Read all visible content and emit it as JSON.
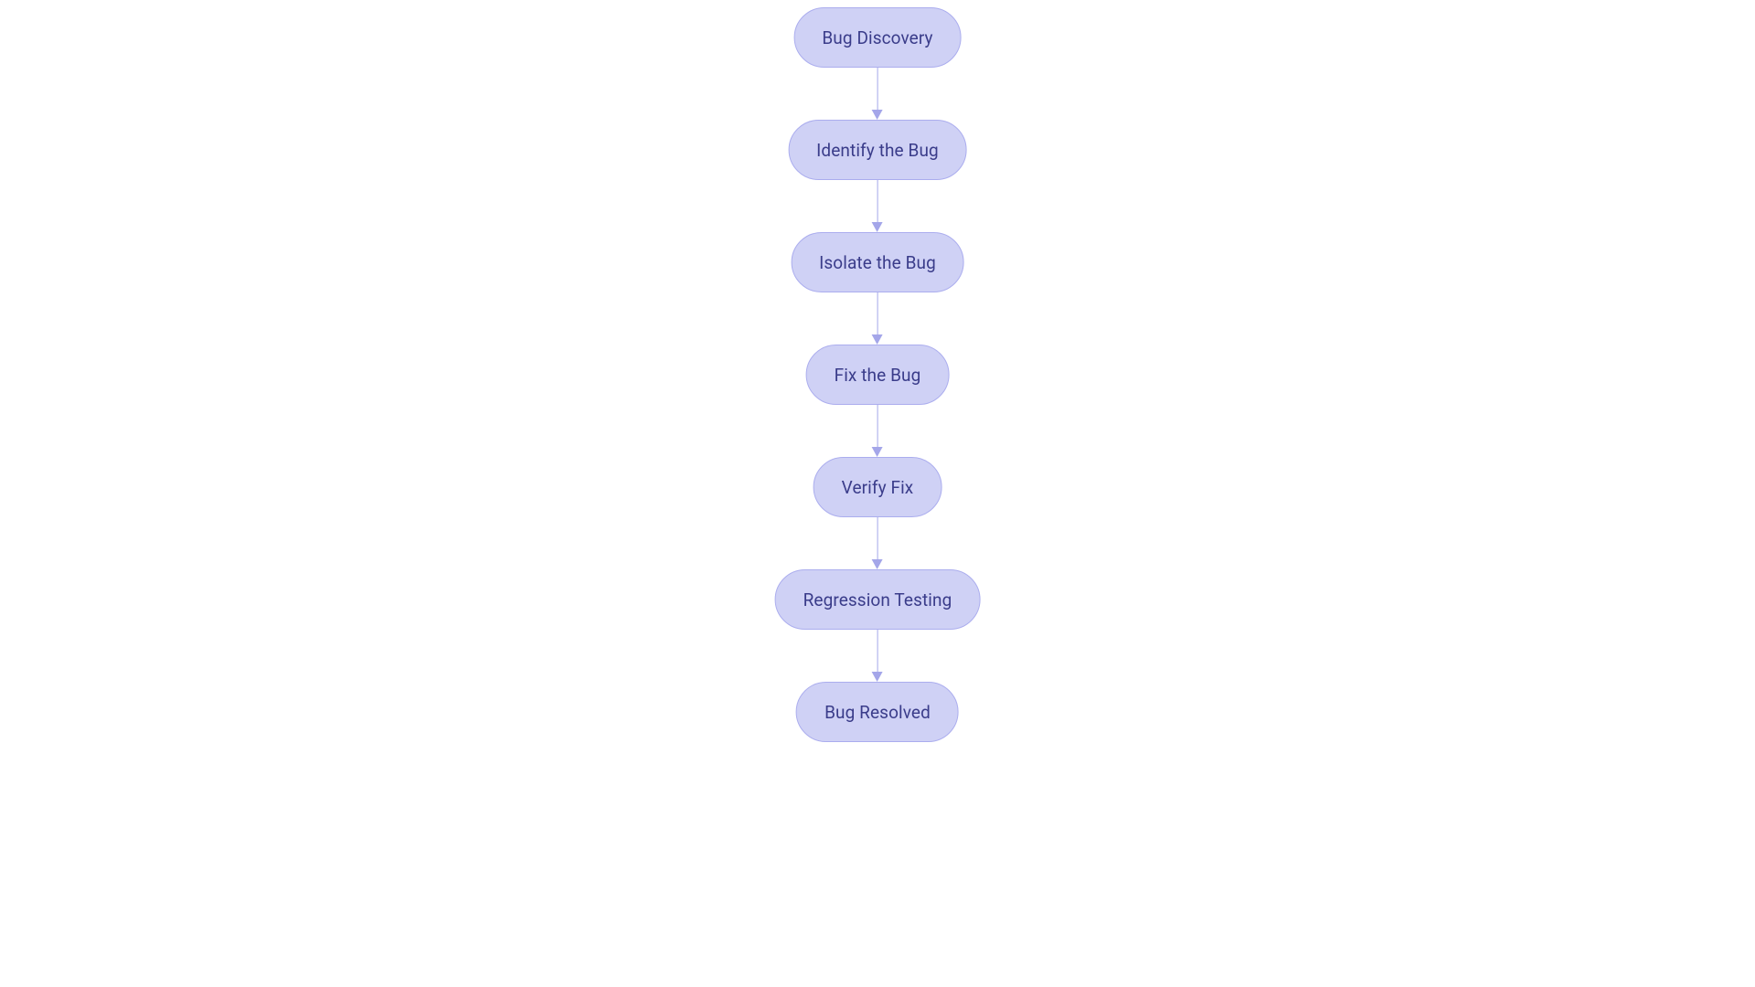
{
  "flowchart": {
    "nodes": [
      {
        "label": "Bug Discovery"
      },
      {
        "label": "Identify the Bug"
      },
      {
        "label": "Isolate the Bug"
      },
      {
        "label": "Fix the Bug"
      },
      {
        "label": "Verify Fix"
      },
      {
        "label": "Regression Testing"
      },
      {
        "label": "Bug Resolved"
      }
    ],
    "colors": {
      "node_fill": "#cfd1f5",
      "node_border": "#abadee",
      "node_text": "#3a3c8a",
      "arrow": "#a4a6e9"
    }
  }
}
